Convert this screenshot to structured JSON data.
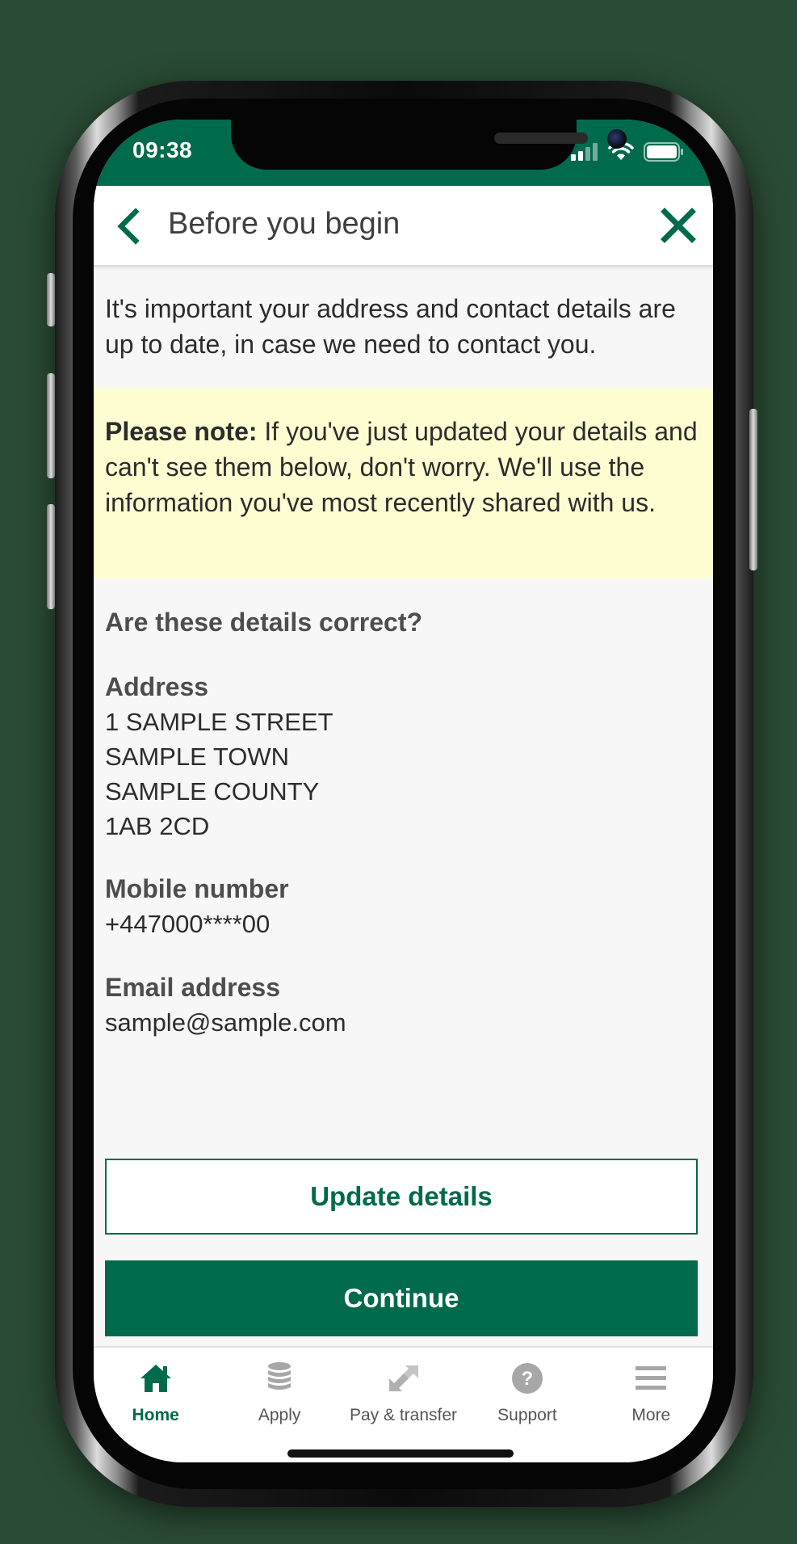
{
  "status_bar": {
    "time": "09:38"
  },
  "header": {
    "title": "Before you begin"
  },
  "intro_text": "It's important your address and contact details are up to date, in case we need to contact you.",
  "note": {
    "label": "Please note:",
    "text": " If you've just updated your details and can't see them below, don't worry. We'll use the information you've most recently shared with us."
  },
  "question": "Are these details correct?",
  "address": {
    "label": "Address",
    "lines": [
      "1 SAMPLE STREET",
      "SAMPLE TOWN",
      "SAMPLE COUNTY",
      "1AB 2CD"
    ]
  },
  "mobile": {
    "label": "Mobile number",
    "value": "+447000****00"
  },
  "email": {
    "label": "Email address",
    "value": "sample@sample.com"
  },
  "buttons": {
    "update": "Update details",
    "continue": "Continue"
  },
  "tabs": [
    {
      "label": "Home",
      "icon": "home-icon",
      "active": true
    },
    {
      "label": "Apply",
      "icon": "coins-stack-icon",
      "active": false
    },
    {
      "label": "Pay & transfer",
      "icon": "transfer-arrows-icon",
      "active": false
    },
    {
      "label": "Support",
      "icon": "question-circle-icon",
      "active": false
    },
    {
      "label": "More",
      "icon": "menu-lines-icon",
      "active": false
    }
  ],
  "colors": {
    "brand_green": "#006a4d",
    "note_background": "#fefdd1",
    "page_background": "#2a4b34"
  }
}
